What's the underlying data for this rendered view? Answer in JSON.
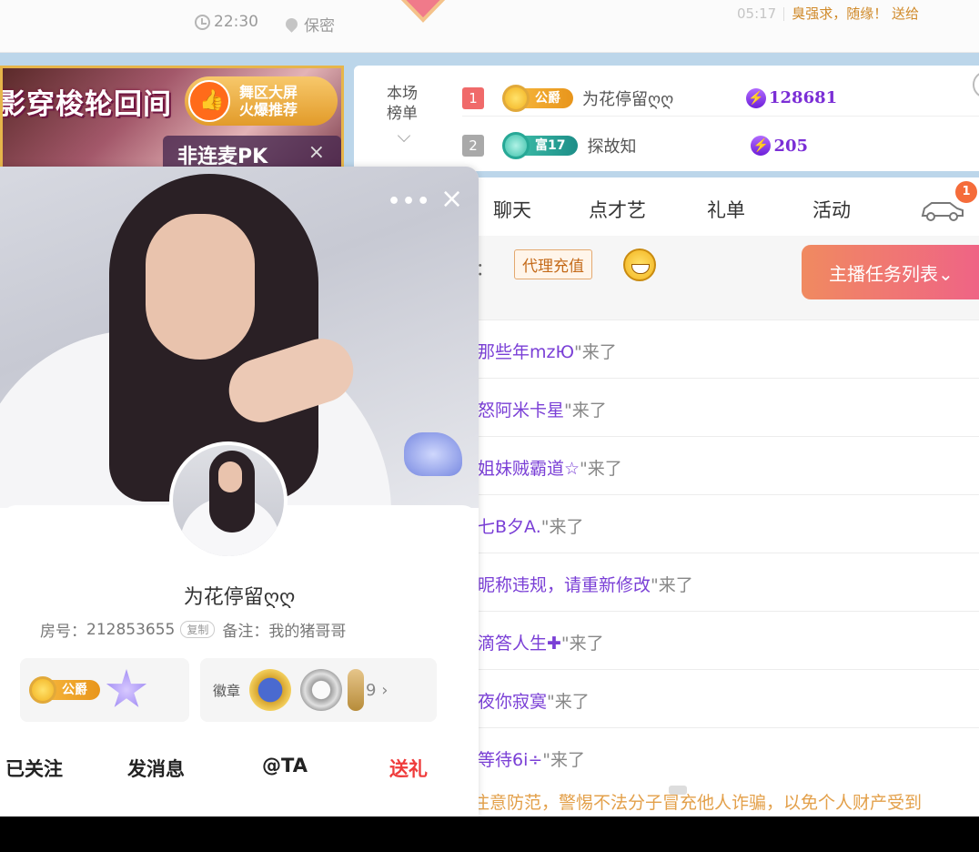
{
  "top": {
    "time": "22:30",
    "location": "保密",
    "clock_right": "05:17",
    "message": "臭强求，随缘！  送给"
  },
  "promo": {
    "title": "影穿梭轮回间",
    "badge_line1": "舞区大屏",
    "badge_line2": "火爆推荐",
    "pk_label": "非连麦PK",
    "pk_close": "×"
  },
  "ranking": {
    "label_line1": "本场",
    "label_line2": "榜单",
    "rows": [
      {
        "rank": "1",
        "level": "公爵",
        "name": "为花停留ღღ",
        "score": "128681",
        "level_color": "#f5b43a"
      },
      {
        "rank": "2",
        "level": "富17",
        "name": "探故知",
        "score": "205",
        "level_color": "#1d8e88"
      }
    ]
  },
  "chat": {
    "tabs": [
      "聊天",
      "点才艺",
      "礼单",
      "活动"
    ],
    "car_badge": "1",
    "colon": "：",
    "agent_recharge": "代理充值",
    "task_list": "主播任务列表⌄",
    "messages": [
      {
        "user": "那些年mzЮ",
        "suffix": "\"来了"
      },
      {
        "user": "怒阿米卡星",
        "suffix": "\"来了"
      },
      {
        "user": "姐妹贼霸道☆",
        "suffix": "\"来了"
      },
      {
        "user": "七B夕A.",
        "suffix": "\"来了"
      },
      {
        "user": "昵称违规，请重新修改",
        "suffix": "\"来了"
      },
      {
        "user": "滴答人生✚",
        "suffix": "\"来了"
      },
      {
        "user": "夜你寂寞",
        "suffix": "\"来了"
      },
      {
        "user": "等待6i÷",
        "suffix": "\"来了"
      }
    ],
    "footer_notice": "注意防范，警惕不法分子冒充他人诈骗，以免个人财产受到"
  },
  "card": {
    "more": "•••",
    "close": "×",
    "nickname": "为花停留ღღ",
    "room_label": "房号：",
    "room_no": "212853655",
    "copy": "复制",
    "note": "备注：我的猪哥哥",
    "level_tag": "公爵",
    "medal_label": "徽章",
    "medal_count": "9",
    "actions": {
      "followed": "已关注",
      "message": "发消息",
      "at": "@TA",
      "gift": "送礼"
    }
  },
  "colors": {
    "accent_red": "#ef3b3b",
    "score_purple": "#7b2ed6",
    "task_gradient_start": "#f08a60",
    "task_gradient_end": "#ef5f8a"
  }
}
